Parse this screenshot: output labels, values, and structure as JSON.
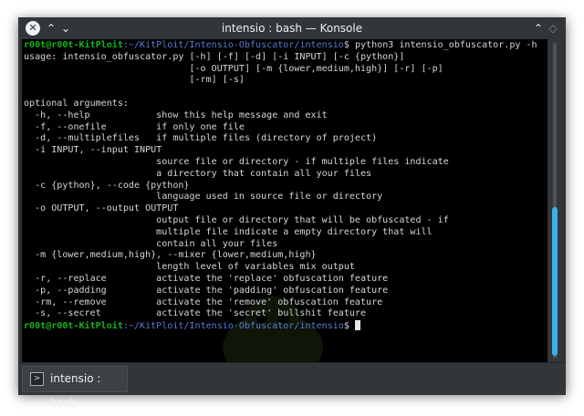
{
  "window": {
    "title": "intensio : bash — Konsole",
    "controls": {
      "close_icon": "close-icon",
      "up_icon": "chevron-up-icon",
      "down_icon": "chevron-down-icon",
      "maximize_icon": "chevron-up-icon",
      "restore_icon": "restore-icon"
    }
  },
  "terminal": {
    "prompt_user": "r00t@r00t-KitPloit",
    "prompt_path": ":~/KitPloit/Intensio-Obfuscator/intensio",
    "prompt_symbol": "$",
    "command": " python3 intensio_obfuscator.py -h",
    "output_lines": [
      "usage: intensio_obfuscator.py [-h] [-f] [-d] [-i INPUT] [-c {python}]",
      "                              [-o OUTPUT] [-m {lower,medium,high}] [-r] [-p]",
      "                              [-rm] [-s]",
      "",
      "optional arguments:",
      "  -h, --help            show this help message and exit",
      "  -f, --onefile         if only one file",
      "  -d, --multiplefiles   if multiple files (directory of project)",
      "  -i INPUT, --input INPUT",
      "                        source file or directory - if multiple files indicate",
      "                        a directory that contain all your files",
      "  -c {python}, --code {python}",
      "                        language used in source file or directory",
      "  -o OUTPUT, --output OUTPUT",
      "                        output file or directory that will be obfuscated - if",
      "                        multiple file indicate a empty directory that will",
      "                        contain all your files",
      "  -m {lower,medium,high}, --mixer {lower,medium,high}",
      "                        length level of variables mix output",
      "  -r, --replace         activate the 'replace' obfuscation feature",
      "  -p, --padding         activate the 'padding' obfuscation feature",
      "  -rm, --remove         activate the 'remove' obfuscation feature",
      "  -s, --secret          activate the 'secret' bullshit feature"
    ],
    "final_prompt_user": "r00t@r00t-KitPloit",
    "final_prompt_path": ":~/KitPloit/Intensio-Obfuscator/intensio",
    "final_prompt_symbol": "$ "
  },
  "scrollbar": {
    "thumb_start_fraction": 0.52,
    "thumb_size_fraction": 0.47
  },
  "tabs": [
    {
      "label": "intensio : bash",
      "icon": "terminal-icon"
    }
  ],
  "colors": {
    "prompt_user": "#18b218",
    "prompt_path": "#5c7bd6",
    "scroll_thumb": "#3daee9",
    "terminal_bg": "#000000",
    "chrome_bg": "#31363b"
  }
}
